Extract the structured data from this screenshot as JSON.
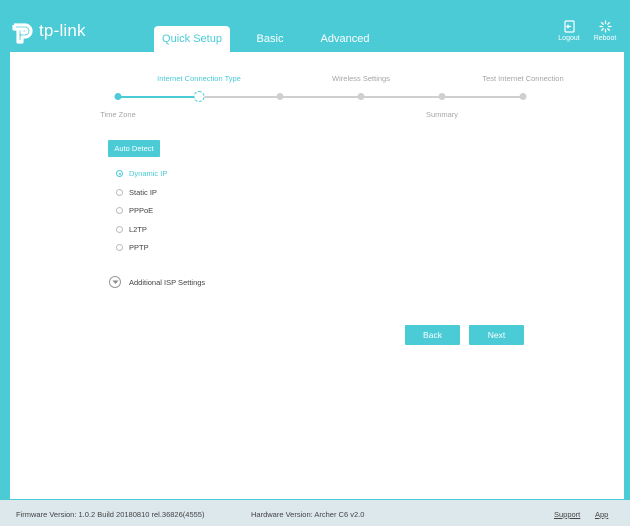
{
  "header": {
    "brand": "tp-link",
    "tabs": [
      {
        "label": "Quick Setup",
        "active": true
      },
      {
        "label": "Basic",
        "active": false
      },
      {
        "label": "Advanced",
        "active": false
      }
    ],
    "logout_label": "Logout",
    "reboot_label": "Reboot"
  },
  "stepper": {
    "steps": [
      {
        "label": "Time Zone",
        "state": "done"
      },
      {
        "label": "Internet Connection Type",
        "state": "current"
      },
      {
        "label": "Wireless Settings",
        "state": "todo"
      },
      {
        "label": "Summary",
        "state": "todo"
      },
      {
        "label": "Test Internet Connection",
        "state": "todo"
      },
      {
        "label": "",
        "state": "todo"
      }
    ]
  },
  "form": {
    "auto_detect_label": "Auto Detect",
    "connection_types": [
      {
        "label": "Dynamic IP",
        "checked": true
      },
      {
        "label": "Static IP",
        "checked": false
      },
      {
        "label": "PPPoE",
        "checked": false
      },
      {
        "label": "L2TP",
        "checked": false
      },
      {
        "label": "PPTP",
        "checked": false
      }
    ],
    "additional_isp_label": "Additional ISP Settings",
    "back_label": "Back",
    "next_label": "Next"
  },
  "footer": {
    "firmware": "Firmware Version: 1.0.2 Build 20180810 rel.36826(4555)",
    "hardware": "Hardware Version: Archer C6 v2.0",
    "support_label": "Support",
    "app_label": "App"
  },
  "colors": {
    "accent": "#4acbd6",
    "inactive": "#cfcfcf",
    "footer_bg": "#dde8ec"
  }
}
